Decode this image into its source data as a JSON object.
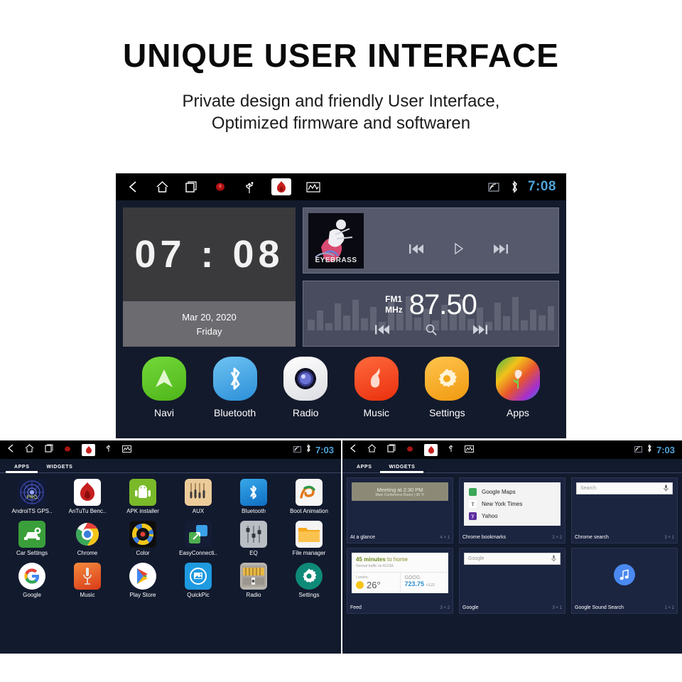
{
  "header": {
    "title": "UNIQUE USER INTERFACE",
    "subtitle_line1": "Private design and friendly User Interface,",
    "subtitle_line2": "Optimized firmware and softwaren"
  },
  "main_unit": {
    "status_bar": {
      "left_icons": [
        "back-icon",
        "home-icon",
        "recents-icon",
        "record-icon",
        "usb-icon",
        "antutu-icon",
        "equalizer-icon"
      ],
      "right_icons": [
        "screencast-icon",
        "bluetooth-icon"
      ],
      "clock": "7:08"
    },
    "clock_widget": {
      "time": "07 : 08",
      "date": "Mar 20, 2020",
      "day": "Friday"
    },
    "music_widget": {
      "album_title": "EYEBRASS",
      "controls": [
        "previous-track",
        "play",
        "next-track"
      ]
    },
    "radio_widget": {
      "band": "FM1",
      "unit": "MHz",
      "frequency": "87.50",
      "controls": [
        "previous-station",
        "scan-search",
        "next-station"
      ]
    },
    "dock_apps": [
      {
        "label": "Navi",
        "icon": "navi-icon",
        "color": "#5fc624"
      },
      {
        "label": "Bluetooth",
        "icon": "bluetooth-icon",
        "color": "#3da4e8"
      },
      {
        "label": "Radio",
        "icon": "radio-icon",
        "color": "#f2f2f2"
      },
      {
        "label": "Music",
        "icon": "music-icon",
        "color": "#f0481f"
      },
      {
        "label": "Settings",
        "icon": "settings-icon",
        "color": "#f5ab22"
      },
      {
        "label": "Apps",
        "icon": "apps-icon",
        "color": "#8ac63f"
      }
    ]
  },
  "apps_panel": {
    "status_bar": {
      "clock": "7:03"
    },
    "tabs": [
      {
        "label": "APPS",
        "selected": true
      },
      {
        "label": "WIDGETS",
        "selected": false
      }
    ],
    "apps": [
      {
        "label": "AndroiTS GPS..",
        "icon": "gps-test-icon",
        "color": "#1a2340"
      },
      {
        "label": "AnTuTu Benc..",
        "icon": "antutu-icon",
        "color": "#ffffff"
      },
      {
        "label": "APK installer",
        "icon": "android-icon",
        "color": "#7ab929"
      },
      {
        "label": "AUX",
        "icon": "aux-icon",
        "color": "#e8c08a"
      },
      {
        "label": "Bluetooth",
        "icon": "bluetooth-icon",
        "color": "#1e8fe0"
      },
      {
        "label": "Boot Animation",
        "icon": "boot-anim-icon",
        "color": "#f4f4f4"
      },
      {
        "label": "Car Settings",
        "icon": "car-settings-icon",
        "color": "#3a9f3a"
      },
      {
        "label": "Chrome",
        "icon": "chrome-icon",
        "color": "#ffffff"
      },
      {
        "label": "Color",
        "icon": "color-icon",
        "color": "#121212"
      },
      {
        "label": "EasyConnecti..",
        "icon": "easyconnect-icon",
        "color": "#1d2a4d"
      },
      {
        "label": "EQ",
        "icon": "eq-icon",
        "color": "#b8bcc2"
      },
      {
        "label": "File manager",
        "icon": "folder-icon",
        "color": "#f6a623"
      },
      {
        "label": "Google",
        "icon": "google-icon",
        "color": "#ffffff"
      },
      {
        "label": "Music",
        "icon": "music-app-icon",
        "color": "#e2502a"
      },
      {
        "label": "Play Store",
        "icon": "play-store-icon",
        "color": "#ffffff"
      },
      {
        "label": "QuickPic",
        "icon": "quickpic-icon",
        "color": "#1e9ae0"
      },
      {
        "label": "Radio",
        "icon": "radio-app-icon",
        "color": "#c9a15c"
      },
      {
        "label": "Settings",
        "icon": "settings-app-icon",
        "color": "#0f8a78"
      }
    ]
  },
  "widgets_panel": {
    "status_bar": {
      "clock": "7:03"
    },
    "tabs": [
      {
        "label": "APPS",
        "selected": false
      },
      {
        "label": "WIDGETS",
        "selected": true
      }
    ],
    "widgets": [
      {
        "name": "At a glance",
        "size": "4 × 1",
        "preview": {
          "type": "glance",
          "line1": "Meeting at 2:30 PM",
          "line2": "Main Conference Room  |  36 °F"
        }
      },
      {
        "name": "Chrome bookmarks",
        "size": "2 × 2",
        "preview": {
          "type": "bookmarks",
          "items": [
            "Google Maps",
            "New York Times",
            "Yahoo"
          ]
        }
      },
      {
        "name": "Chrome search",
        "size": "3 × 1",
        "preview": {
          "type": "search",
          "placeholder": "Search"
        }
      },
      {
        "name": "Feed",
        "size": "3 × 2",
        "preview": {
          "type": "feed",
          "eta": "45 minutes",
          "eta_tail": " to home",
          "traffic": "Normal traffic on A123A",
          "city": "London",
          "temp": "26°",
          "ticker": "GOOG",
          "price": "723.75",
          "delta": "+3.21"
        }
      },
      {
        "name": "Google",
        "size": "3 × 1",
        "preview": {
          "type": "search",
          "placeholder": "Google"
        }
      },
      {
        "name": "Google Sound Search",
        "size": "1 × 1",
        "preview": {
          "type": "sound",
          "icon": "music-note-icon"
        }
      }
    ]
  }
}
